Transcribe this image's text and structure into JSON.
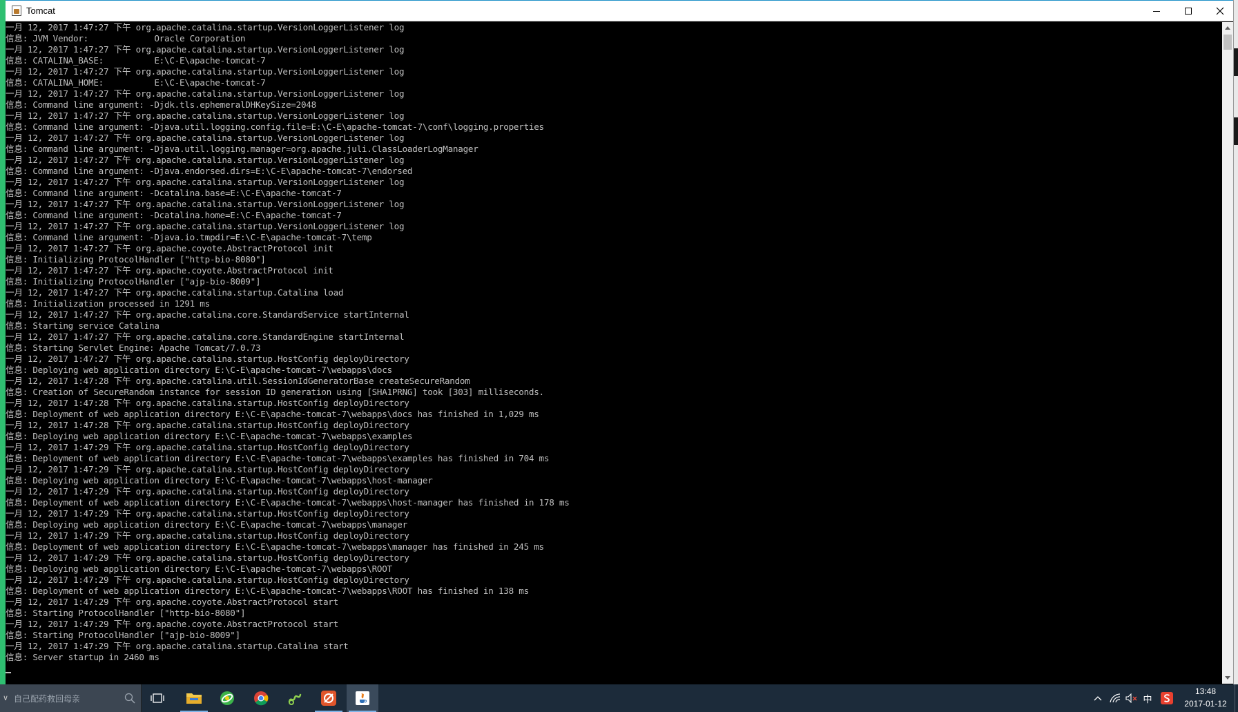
{
  "window": {
    "title": "Tomcat"
  },
  "console": {
    "lines": [
      "一月 12, 2017 1:47:27 下午 org.apache.catalina.startup.VersionLoggerListener log",
      "信息: JVM Vendor:             Oracle Corporation",
      "一月 12, 2017 1:47:27 下午 org.apache.catalina.startup.VersionLoggerListener log",
      "信息: CATALINA_BASE:          E:\\C-E\\apache-tomcat-7",
      "一月 12, 2017 1:47:27 下午 org.apache.catalina.startup.VersionLoggerListener log",
      "信息: CATALINA_HOME:          E:\\C-E\\apache-tomcat-7",
      "一月 12, 2017 1:47:27 下午 org.apache.catalina.startup.VersionLoggerListener log",
      "信息: Command line argument: -Djdk.tls.ephemeralDHKeySize=2048",
      "一月 12, 2017 1:47:27 下午 org.apache.catalina.startup.VersionLoggerListener log",
      "信息: Command line argument: -Djava.util.logging.config.file=E:\\C-E\\apache-tomcat-7\\conf\\logging.properties",
      "一月 12, 2017 1:47:27 下午 org.apache.catalina.startup.VersionLoggerListener log",
      "信息: Command line argument: -Djava.util.logging.manager=org.apache.juli.ClassLoaderLogManager",
      "一月 12, 2017 1:47:27 下午 org.apache.catalina.startup.VersionLoggerListener log",
      "信息: Command line argument: -Djava.endorsed.dirs=E:\\C-E\\apache-tomcat-7\\endorsed",
      "一月 12, 2017 1:47:27 下午 org.apache.catalina.startup.VersionLoggerListener log",
      "信息: Command line argument: -Dcatalina.base=E:\\C-E\\apache-tomcat-7",
      "一月 12, 2017 1:47:27 下午 org.apache.catalina.startup.VersionLoggerListener log",
      "信息: Command line argument: -Dcatalina.home=E:\\C-E\\apache-tomcat-7",
      "一月 12, 2017 1:47:27 下午 org.apache.catalina.startup.VersionLoggerListener log",
      "信息: Command line argument: -Djava.io.tmpdir=E:\\C-E\\apache-tomcat-7\\temp",
      "一月 12, 2017 1:47:27 下午 org.apache.coyote.AbstractProtocol init",
      "信息: Initializing ProtocolHandler [\"http-bio-8080\"]",
      "一月 12, 2017 1:47:27 下午 org.apache.coyote.AbstractProtocol init",
      "信息: Initializing ProtocolHandler [\"ajp-bio-8009\"]",
      "一月 12, 2017 1:47:27 下午 org.apache.catalina.startup.Catalina load",
      "信息: Initialization processed in 1291 ms",
      "一月 12, 2017 1:47:27 下午 org.apache.catalina.core.StandardService startInternal",
      "信息: Starting service Catalina",
      "一月 12, 2017 1:47:27 下午 org.apache.catalina.core.StandardEngine startInternal",
      "信息: Starting Servlet Engine: Apache Tomcat/7.0.73",
      "一月 12, 2017 1:47:27 下午 org.apache.catalina.startup.HostConfig deployDirectory",
      "信息: Deploying web application directory E:\\C-E\\apache-tomcat-7\\webapps\\docs",
      "一月 12, 2017 1:47:28 下午 org.apache.catalina.util.SessionIdGeneratorBase createSecureRandom",
      "信息: Creation of SecureRandom instance for session ID generation using [SHA1PRNG] took [303] milliseconds.",
      "一月 12, 2017 1:47:28 下午 org.apache.catalina.startup.HostConfig deployDirectory",
      "信息: Deployment of web application directory E:\\C-E\\apache-tomcat-7\\webapps\\docs has finished in 1,029 ms",
      "一月 12, 2017 1:47:28 下午 org.apache.catalina.startup.HostConfig deployDirectory",
      "信息: Deploying web application directory E:\\C-E\\apache-tomcat-7\\webapps\\examples",
      "一月 12, 2017 1:47:29 下午 org.apache.catalina.startup.HostConfig deployDirectory",
      "信息: Deployment of web application directory E:\\C-E\\apache-tomcat-7\\webapps\\examples has finished in 704 ms",
      "一月 12, 2017 1:47:29 下午 org.apache.catalina.startup.HostConfig deployDirectory",
      "信息: Deploying web application directory E:\\C-E\\apache-tomcat-7\\webapps\\host-manager",
      "一月 12, 2017 1:47:29 下午 org.apache.catalina.startup.HostConfig deployDirectory",
      "信息: Deployment of web application directory E:\\C-E\\apache-tomcat-7\\webapps\\host-manager has finished in 178 ms",
      "一月 12, 2017 1:47:29 下午 org.apache.catalina.startup.HostConfig deployDirectory",
      "信息: Deploying web application directory E:\\C-E\\apache-tomcat-7\\webapps\\manager",
      "一月 12, 2017 1:47:29 下午 org.apache.catalina.startup.HostConfig deployDirectory",
      "信息: Deployment of web application directory E:\\C-E\\apache-tomcat-7\\webapps\\manager has finished in 245 ms",
      "一月 12, 2017 1:47:29 下午 org.apache.catalina.startup.HostConfig deployDirectory",
      "信息: Deploying web application directory E:\\C-E\\apache-tomcat-7\\webapps\\ROOT",
      "一月 12, 2017 1:47:29 下午 org.apache.catalina.startup.HostConfig deployDirectory",
      "信息: Deployment of web application directory E:\\C-E\\apache-tomcat-7\\webapps\\ROOT has finished in 138 ms",
      "一月 12, 2017 1:47:29 下午 org.apache.coyote.AbstractProtocol start",
      "信息: Starting ProtocolHandler [\"http-bio-8080\"]",
      "一月 12, 2017 1:47:29 下午 org.apache.coyote.AbstractProtocol start",
      "信息: Starting ProtocolHandler [\"ajp-bio-8009\"]",
      "一月 12, 2017 1:47:29 下午 org.apache.catalina.startup.Catalina start",
      "信息: Server startup in 2460 ms"
    ]
  },
  "taskbar": {
    "search_placeholder": "自己配药救回母亲",
    "apps": [
      {
        "name": "task-view",
        "icon": "task-view-icon"
      },
      {
        "name": "file-explorer",
        "icon": "folder-icon"
      },
      {
        "name": "browser-360",
        "icon": "browser-360-icon"
      },
      {
        "name": "chrome",
        "icon": "chrome-icon"
      },
      {
        "name": "app-green",
        "icon": "green-app-icon"
      },
      {
        "name": "app-orange",
        "icon": "orange-app-icon"
      },
      {
        "name": "java",
        "icon": "java-icon"
      }
    ],
    "tray": {
      "ime": "中",
      "time": "13:48",
      "date": "2017-01-12"
    }
  },
  "colors": {
    "title_accent": "#1e90c8",
    "console_text": "#c0c0c0",
    "console_bg": "#000000",
    "taskbar_bg": "#1c2b3a"
  }
}
